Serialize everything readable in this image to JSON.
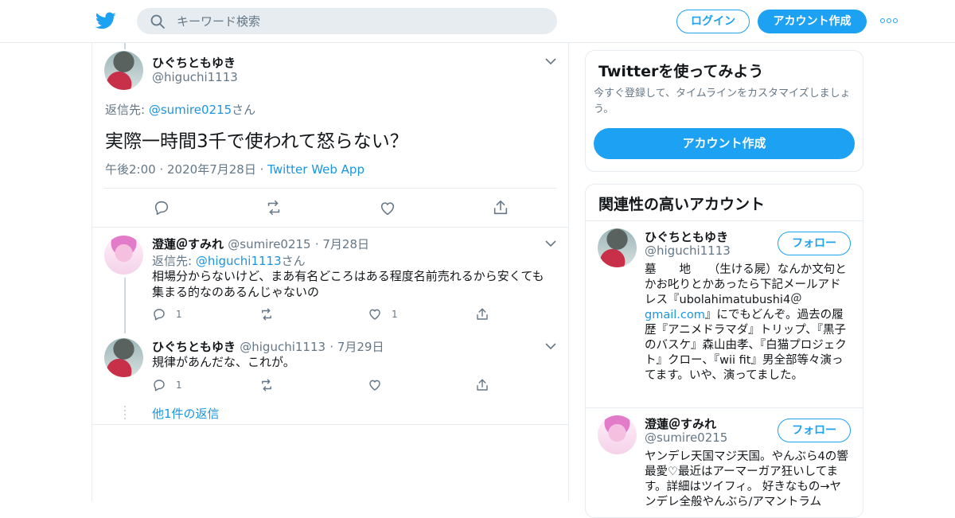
{
  "header": {
    "search_placeholder": "キーワード検索",
    "login_label": "ログイン",
    "signup_label": "アカウント作成"
  },
  "tweet": {
    "author_name": "ひぐちともゆき",
    "author_handle": "@higuchi1113",
    "reply_prefix": "返信先: ",
    "reply_to": "@sumire0215",
    "reply_suffix": "さん",
    "text": "実際一時間3千で使われて怒らない？",
    "time": "午後2:00",
    "date": "2020年7月28日",
    "source": "Twitter Web App"
  },
  "replies": [
    {
      "name": "澄蓮＠すみれ",
      "handle": "@sumire0215",
      "date": "7月28日",
      "reply_prefix": "返信先: ",
      "reply_to": "@higuchi1113",
      "reply_suffix": "さん",
      "text": "相場分からないけど、まあ有名どころはある程度名前売れるから安くても集まる的なのあるんじゃないの",
      "reply_count": "1",
      "like_count": "1"
    },
    {
      "name": "ひぐちともゆき",
      "handle": "@higuchi1113",
      "date": "7月29日",
      "text": "規律があんだな、これが。",
      "reply_count": "1"
    }
  ],
  "more_replies_label": "他1件の返信",
  "sidebar": {
    "signup_card": {
      "title": "Twitterを使ってみよう",
      "subtitle": "今すぐ登録して、タイムラインをカスタマイズしましょう。",
      "button": "アカウント作成"
    },
    "related": {
      "title": "関連性の高いアカウント",
      "follow_label": "フォロー",
      "accounts": [
        {
          "name": "ひぐちともゆき",
          "handle": "@higuchi1113",
          "bio_pre": "墓　　地　　（生ける屍）なんか文句とかお叱りとかあったら下記メールアドレス『ubolahimatubushi4＠",
          "bio_link": "gmail.com",
          "bio_post": "』にでもどんぞ。過去の履歴『アニメドラマダ』トリップ、『黒子のバスケ』森山由孝、『白猫プロジェクト』クロー、『wii fit』男全部等々演ってます。いや、演ってました。"
        },
        {
          "name": "澄蓮＠すみれ",
          "handle": "@sumire0215",
          "bio": "ヤンデレ天国マジ天国。やんぶら4の響最愛♡最近はアーマーガア狂いしてます。詳細はツイフィ。 好きなもの→ヤンデレ全般やんぶら/アマントラム"
        }
      ]
    }
  }
}
